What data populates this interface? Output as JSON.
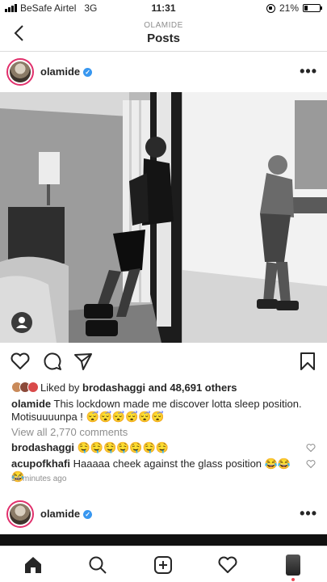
{
  "status_bar": {
    "carrier": "BeSafe Airtel",
    "network": "3G",
    "time": "11:31",
    "battery": "21%",
    "battery_level": 0.21
  },
  "nav": {
    "subtitle": "OLAMIDE",
    "title": "Posts"
  },
  "post": {
    "username": "olamide",
    "verified": true,
    "liked_by_prefix": "Liked by",
    "liked_by_user": "brodashaggi",
    "likes_suffix": "and 48,691 others",
    "caption_user": "olamide",
    "caption_text": "This lockdown made me discover lotta sleep position. Motisuuuunpa ! 😴😴😴😴😴😴",
    "view_all_comments": "View all 2,770 comments",
    "comments": [
      {
        "user": "brodashaggi",
        "text": "🤤🤤🤤🤤🤤🤤🤤"
      },
      {
        "user": "acupofkhafi",
        "text": "Haaaaa cheek against the glass position 😂😂😂"
      }
    ],
    "time_ago": "54 minutes ago"
  },
  "post2": {
    "username": "olamide"
  },
  "colors": {
    "accent": "#3897f0",
    "text": "#262626",
    "muted": "#8e8e8e",
    "divider": "#dbdbdb",
    "notification": "#ed4956"
  },
  "icons": {
    "back": "chevron-left-icon",
    "more": "more-dots-icon",
    "like": "heart-icon",
    "comment": "comment-bubble-icon",
    "share": "paper-plane-icon",
    "save": "bookmark-icon",
    "home": "home-icon",
    "search": "search-icon",
    "new_post": "plus-square-icon",
    "activity": "heart-icon",
    "profile": "profile-avatar-icon"
  }
}
